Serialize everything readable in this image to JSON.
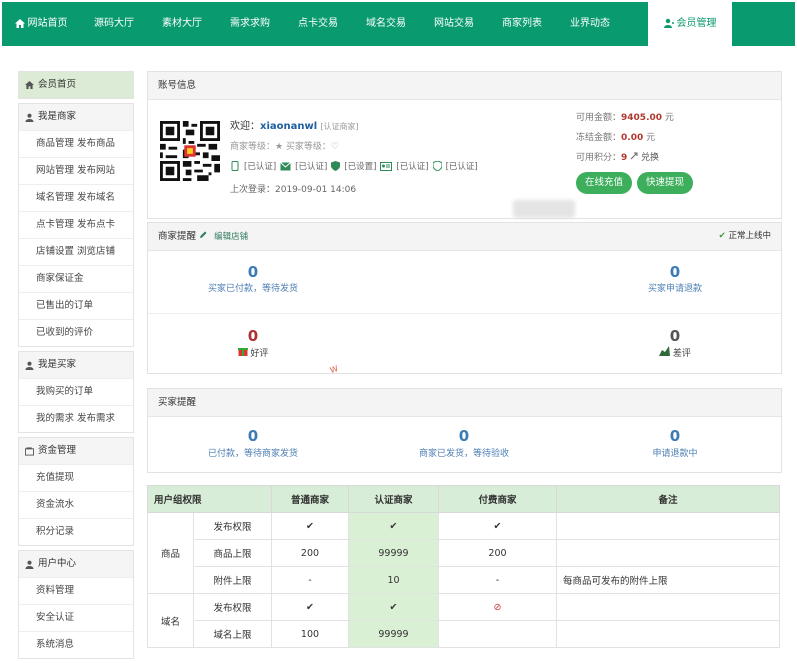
{
  "nav": {
    "items": [
      "网站首页",
      "源码大厅",
      "素材大厅",
      "需求求购",
      "点卡交易",
      "域名交易",
      "网站交易",
      "商家列表",
      "业界动态"
    ],
    "active": "会员管理"
  },
  "sidebar": {
    "groups": [
      {
        "title": "会员首页",
        "active": true,
        "icon": "home-icon",
        "items": []
      },
      {
        "title": "我是商家",
        "icon": "user-icon",
        "items": [
          "商品管理 发布商品",
          "网站管理 发布网站",
          "域名管理 发布域名",
          "点卡管理 发布点卡",
          "店铺设置 浏览店铺",
          "商家保证金",
          "已售出的订单",
          "已收到的评价"
        ]
      },
      {
        "title": "我是买家",
        "icon": "user-icon",
        "items": [
          "我购买的订单",
          "我的需求 发布需求"
        ]
      },
      {
        "title": "资金管理",
        "icon": "wallet-icon",
        "items": [
          "充值提现",
          "资金流水",
          "积分记录"
        ]
      },
      {
        "title": "用户中心",
        "icon": "user-icon",
        "items": [
          "资料管理",
          "安全认证",
          "系统消息"
        ]
      }
    ]
  },
  "account": {
    "title": "账号信息",
    "welcome_prefix": "欢迎：",
    "username": "xiaonanwl",
    "tag": "[认证商家]",
    "levels": "商家等级：★ 买家等级：♡",
    "badges": [
      "[已认证]",
      "[已认证]",
      "[已设置]",
      "[已认证]",
      "[已认证]"
    ],
    "last_login": "上次登录：2019-09-01 14:06",
    "available_label": "可用金额：",
    "available_value": "9405.00",
    "frozen_label": "冻结金额：",
    "frozen_value": "0.00",
    "points_label": "可用积分：",
    "points_value": "9",
    "exchange": "兑换",
    "unit": "元",
    "recharge_btn": "在线充值",
    "withdraw_btn": "快速提现"
  },
  "merchant": {
    "title": "商家提醒",
    "edit": "编辑店铺",
    "status": "正常上线中",
    "stats": [
      {
        "value": "0",
        "label": "买家已付款，等待发货"
      },
      {
        "value": "0",
        "label": "买家申请退款"
      },
      {
        "value": "0",
        "label": "好评"
      },
      {
        "value": "0",
        "label": "差评"
      }
    ]
  },
  "buyer": {
    "title": "买家提醒",
    "stats": [
      {
        "value": "0",
        "label": "已付款，等待商家发货"
      },
      {
        "value": "0",
        "label": "商家已发货，等待验收"
      },
      {
        "value": "0",
        "label": "申请退款中"
      }
    ]
  },
  "permissions": {
    "headers": [
      "用户组权限",
      "普通商家",
      "认证商家",
      "付费商家",
      "备注"
    ],
    "rows": [
      {
        "group": "商品",
        "item": "发布权限",
        "c1": "✔",
        "c2": "✔",
        "c3": "✔",
        "note": ""
      },
      {
        "group": "",
        "item": "商品上限",
        "c1": "200",
        "c2": "99999",
        "c3": "200",
        "note": ""
      },
      {
        "group": "",
        "item": "附件上限",
        "c1": "-",
        "c2": "10",
        "c3": "-",
        "note": "每商品可发布的附件上限"
      },
      {
        "group": "域名",
        "item": "发布权限",
        "c1": "✔",
        "c2": "✔",
        "c3": "⊘",
        "note": ""
      },
      {
        "group": "",
        "item": "域名上限",
        "c1": "100",
        "c2": "99999",
        "c3": "",
        "note": ""
      }
    ]
  },
  "colors": {
    "brand": "#0a9a6f",
    "accent": "#3cae5c",
    "money": "#b0392f",
    "number": "#3d7bb5"
  }
}
